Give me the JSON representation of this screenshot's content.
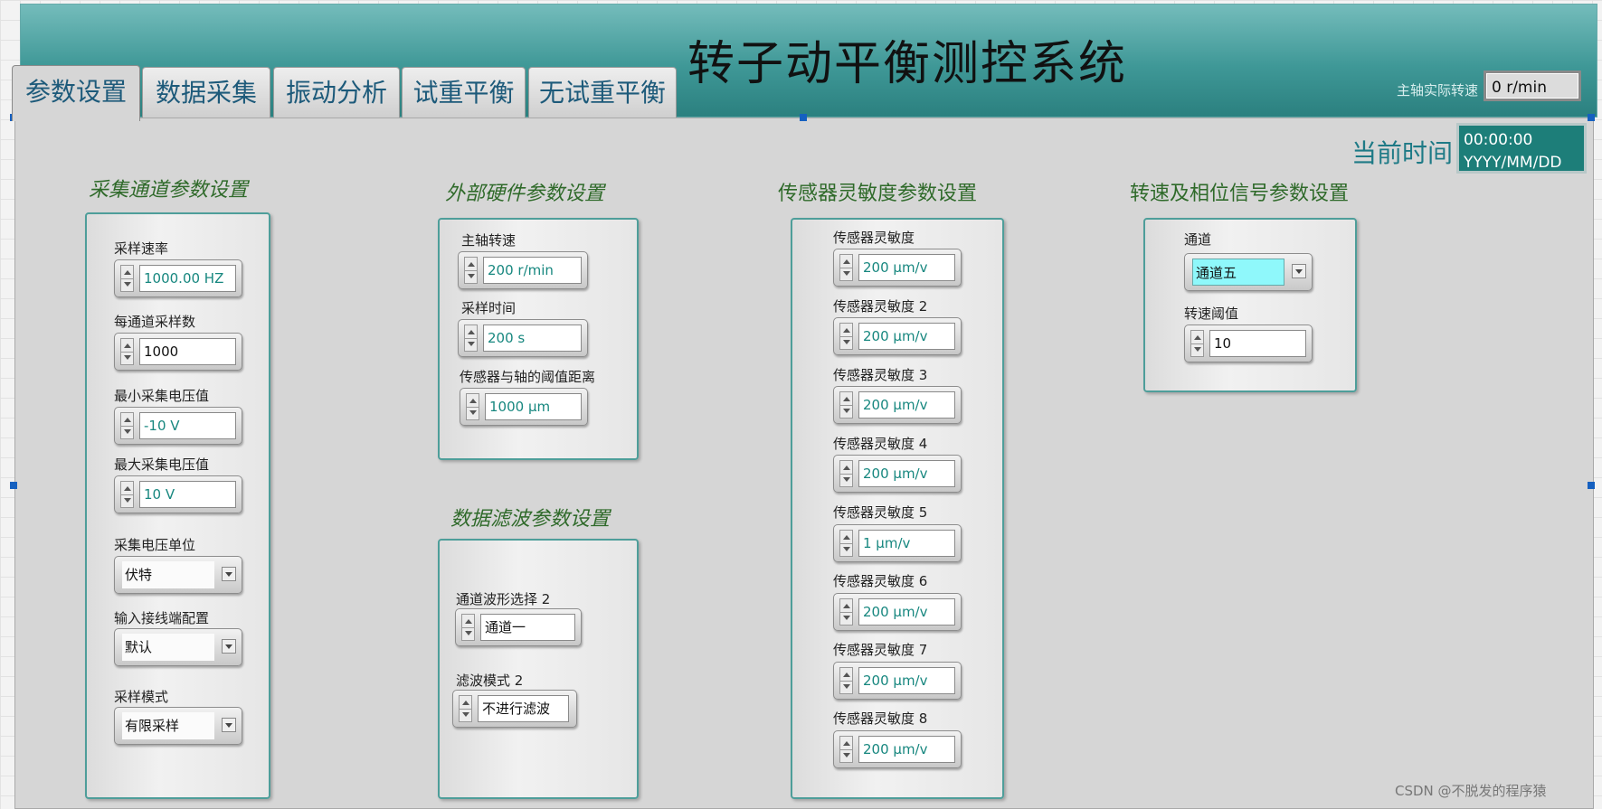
{
  "app": {
    "title": "转子动平衡测控系统"
  },
  "tabs": [
    {
      "label": "参数设置",
      "active": true
    },
    {
      "label": "数据采集",
      "active": false
    },
    {
      "label": "振动分析",
      "active": false
    },
    {
      "label": "试重平衡",
      "active": false
    },
    {
      "label": "无试重平衡",
      "active": false
    }
  ],
  "spindle": {
    "label": "主轴实际转速",
    "value": "0 r/min"
  },
  "clock": {
    "label": "当前时间",
    "time": "00:00:00",
    "date": "YYYY/MM/DD"
  },
  "acq": {
    "title": "采集通道参数设置",
    "sample_rate": {
      "label": "采样速率",
      "value": "1000.00  HZ"
    },
    "samples_per_channel": {
      "label": "每通道采样数",
      "value": "1000"
    },
    "min_voltage": {
      "label": "最小采集电压值",
      "value": "-10  V"
    },
    "max_voltage": {
      "label": "最大采集电压值",
      "value": "10  V"
    },
    "voltage_unit": {
      "label": "采集电压单位",
      "value": "伏特"
    },
    "terminal_config": {
      "label": "输入接线端配置",
      "value": "默认"
    },
    "sample_mode": {
      "label": "采样模式",
      "value": "有限采样"
    }
  },
  "hw": {
    "title": "外部硬件参数设置",
    "spindle_speed": {
      "label": "主轴转速",
      "value": "200  r/min"
    },
    "sample_time": {
      "label": "采样时间",
      "value": "200  s"
    },
    "threshold_distance": {
      "label": "传感器与轴的阈值距离",
      "value": "1000  μm"
    }
  },
  "filter": {
    "title": "数据滤波参数设置",
    "waveform_select": {
      "label": "通道波形选择 2",
      "value": "通道一"
    },
    "filter_mode": {
      "label": "滤波模式 2",
      "value": "不进行滤波"
    }
  },
  "sensor": {
    "title": "传感器灵敏度参数设置",
    "items": [
      {
        "label": "传感器灵敏度",
        "value": "200  μm/v"
      },
      {
        "label": "传感器灵敏度 2",
        "value": "200  μm/v"
      },
      {
        "label": "传感器灵敏度 3",
        "value": "200  μm/v"
      },
      {
        "label": "传感器灵敏度 4",
        "value": "200  μm/v"
      },
      {
        "label": "传感器灵敏度 5",
        "value": "1  μm/v"
      },
      {
        "label": "传感器灵敏度 6",
        "value": "200  μm/v"
      },
      {
        "label": "传感器灵敏度 7",
        "value": "200  μm/v"
      },
      {
        "label": "传感器灵敏度 8",
        "value": "200  μm/v"
      }
    ]
  },
  "speed_phase": {
    "title": "转速及相位信号参数设置",
    "channel": {
      "label": "通道",
      "value": "通道五"
    },
    "speed_threshold": {
      "label": "转速阈值",
      "value": "10"
    }
  },
  "watermark": "CSDN @不脱发的程序猿",
  "colors": {
    "header_teal": "#3f9897",
    "title_teal": "#1e7a86",
    "section_green": "#2f6a2a",
    "value_teal": "#17877f",
    "highlight_cyan": "#8ff8fb"
  }
}
